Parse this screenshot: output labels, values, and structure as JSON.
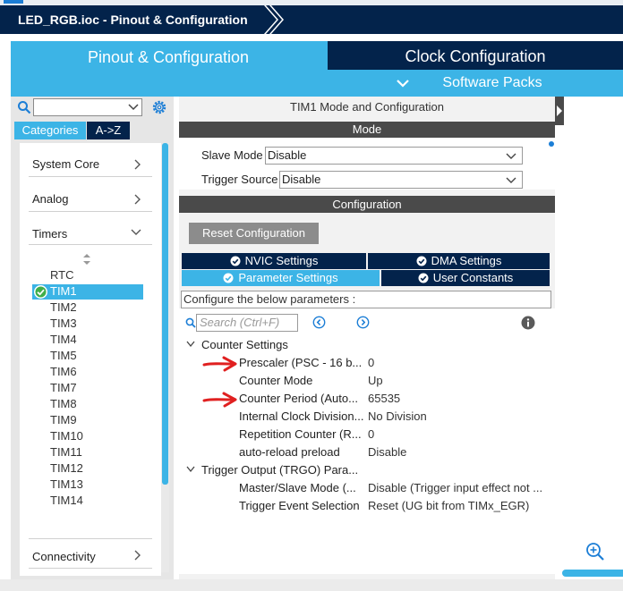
{
  "window": {
    "breadcrumb": "LED_RGB.ioc - Pinout & Configuration"
  },
  "main_tabs": {
    "pinout": "Pinout & Configuration",
    "clock": "Clock Configuration",
    "software_packs": "Software Packs"
  },
  "left": {
    "category_select_value": "",
    "tab_categories": "Categories",
    "tab_az": "A->Z",
    "categories": [
      "System Core",
      "Analog",
      "Timers",
      "Connectivity"
    ],
    "timers": [
      "RTC",
      "TIM1",
      "TIM2",
      "TIM3",
      "TIM4",
      "TIM5",
      "TIM6",
      "TIM7",
      "TIM8",
      "TIM9",
      "TIM10",
      "TIM11",
      "TIM12",
      "TIM13",
      "TIM14"
    ],
    "selected_timer": "TIM1"
  },
  "mode": {
    "title": "TIM1 Mode and Configuration",
    "header": "Mode",
    "slave_mode_label": "Slave Mode",
    "slave_mode_value": "Disable",
    "trigger_source_label": "Trigger Source",
    "trigger_source_value": "Disable"
  },
  "config": {
    "header": "Configuration",
    "reset_button": "Reset Configuration",
    "tabs": {
      "nvic": "NVIC Settings",
      "dma": "DMA Settings",
      "parameter": "Parameter Settings",
      "user_constants": "User Constants"
    },
    "intro": "Configure the below parameters :",
    "search_placeholder": "Search (Ctrl+F)",
    "groups": [
      {
        "name": "Counter Settings",
        "params": [
          {
            "name": "Prescaler (PSC - 16 b...",
            "value": "0"
          },
          {
            "name": "Counter Mode",
            "value": "Up"
          },
          {
            "name": "Counter Period (Auto...",
            "value": "65535"
          },
          {
            "name": "Internal Clock Division...",
            "value": "No Division"
          },
          {
            "name": "Repetition Counter (R...",
            "value": "0"
          },
          {
            "name": "auto-reload preload",
            "value": "Disable"
          }
        ]
      },
      {
        "name": "Trigger Output (TRGO) Para...",
        "params": [
          {
            "name": "Master/Slave Mode (...",
            "value": "Disable (Trigger input effect not ..."
          },
          {
            "name": "Trigger Event Selection",
            "value": "Reset (UG bit from TIMx_EGR)"
          }
        ]
      }
    ]
  },
  "colors": {
    "navy": "#03234b",
    "accent": "#3cb4e6",
    "annotation_arrow": "#e02020"
  },
  "icons": {
    "search": "search-icon",
    "gear": "gear-icon",
    "check": "check-circle-icon",
    "info": "info-icon",
    "zoom": "zoom-in-icon"
  }
}
